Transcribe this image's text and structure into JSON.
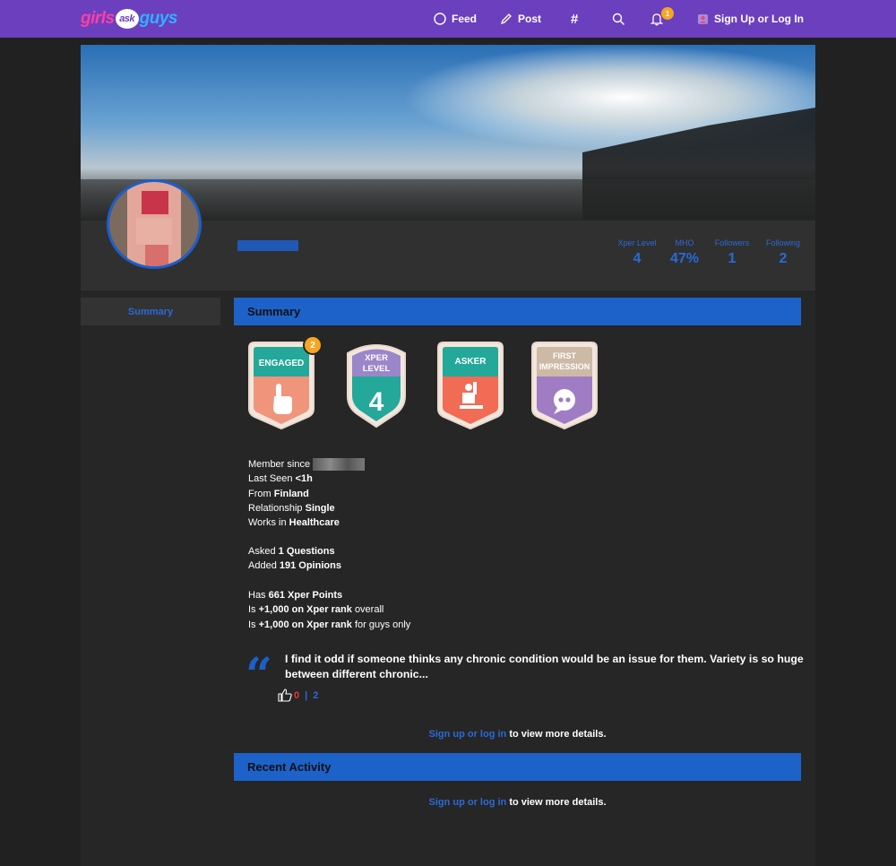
{
  "nav": {
    "logo": {
      "part1": "girls",
      "part2": "ask",
      "part3": "guys"
    },
    "feed": "Feed",
    "post": "Post",
    "hashtag": "#",
    "notification_count": "1",
    "signup": "Sign Up or Log In"
  },
  "profile": {
    "stats": [
      {
        "label": "Xper Level",
        "value": "4"
      },
      {
        "label": "MHO",
        "value": "47%"
      },
      {
        "label": "Followers",
        "value": "1"
      },
      {
        "label": "Following",
        "value": "2"
      }
    ]
  },
  "sidebar": {
    "summary_tab": "Summary"
  },
  "summary": {
    "heading": "Summary",
    "badges": [
      {
        "title": "ENGAGED",
        "count": "2"
      },
      {
        "title_line1": "XPER",
        "title_line2": "LEVEL",
        "number": "4"
      },
      {
        "title": "ASKER"
      },
      {
        "title_line1": "FIRST",
        "title_line2": "IMPRESSION"
      }
    ],
    "member_since": "Member since",
    "last_seen_label": "Last Seen",
    "last_seen_value": "<1h",
    "from_label": "From",
    "from_value": "Finland",
    "relationship_label": "Relationship",
    "relationship_value": "Single",
    "works_label": "Works in",
    "works_value": "Healthcare",
    "asked_label": "Asked",
    "asked_value": "1 Questions",
    "added_label": "Added",
    "added_value": "191 Opinions",
    "has_label": "Has",
    "has_value": "661 Xper Points",
    "rank1_label": "Is",
    "rank1_value": "+1,000 on Xper rank",
    "rank1_suffix": "overall",
    "rank2_label": "Is",
    "rank2_value": "+1,000 on Xper rank",
    "rank2_suffix": "for guys only",
    "quote": "I find it odd if someone thinks any chronic condition would be an issue for them. Variety is so huge between different chronic...",
    "quote_down": "0",
    "quote_sep": "|",
    "quote_up": "2",
    "signup_link": "Sign up or log in",
    "signup_suffix": "to view more details."
  },
  "recent": {
    "heading": "Recent Activity",
    "signup_link": "Sign up or log in",
    "signup_suffix": "to view more details."
  },
  "colors": {
    "nav": "#6c3fbe",
    "accent": "#1d62c8",
    "badge": "#f5a623"
  }
}
